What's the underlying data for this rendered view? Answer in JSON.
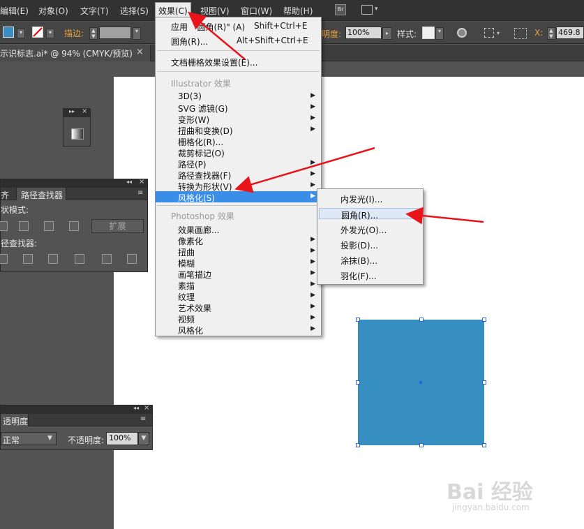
{
  "menubar": {
    "items": [
      "编辑(E)",
      "对象(O)",
      "文字(T)",
      "选择(S)",
      "效果(C)",
      "视图(V)",
      "窗口(W)",
      "帮助(H)"
    ],
    "bridge_label": "Br"
  },
  "control_bar": {
    "stroke_label": "描边:",
    "opacity_label": "明度:",
    "opacity_value": "100%",
    "style_label": "样式:",
    "x_label": "X:",
    "x_value": "469.8"
  },
  "document_tab": {
    "title": "示识标志.ai* @ 94% (CMYK/预览)",
    "close": "×"
  },
  "effect_menu": {
    "apply_label": "应用",
    "apply_arg": "\"圆角(R)\" (A)",
    "apply_shortcut": "Shift+Ctrl+E",
    "last_label": "圆角(R)...",
    "last_shortcut": "Alt+Shift+Ctrl+E",
    "raster_settings": "文档栅格效果设置(E)...",
    "illustrator_header": "Illustrator 效果",
    "illustrator_items": [
      "3D(3)",
      "SVG 滤镜(G)",
      "变形(W)",
      "扭曲和变换(D)",
      "栅格化(R)...",
      "裁剪标记(O)",
      "路径(P)",
      "路径查找器(F)",
      "转换为形状(V)",
      "风格化(S)"
    ],
    "illustrator_has_sub": [
      true,
      true,
      true,
      true,
      false,
      false,
      true,
      true,
      true,
      true
    ],
    "photoshop_header": "Photoshop 效果",
    "photoshop_items": [
      "效果画廊...",
      "像素化",
      "扭曲",
      "模糊",
      "画笔描边",
      "素描",
      "纹理",
      "艺术效果",
      "视频",
      "风格化"
    ],
    "photoshop_has_sub": [
      false,
      true,
      true,
      true,
      true,
      true,
      true,
      true,
      true,
      true
    ]
  },
  "stylize_submenu": {
    "items": [
      "内发光(I)...",
      "圆角(R)...",
      "外发光(O)...",
      "投影(D)...",
      "涂抹(B)...",
      "羽化(F)..."
    ]
  },
  "pathfinder_panel": {
    "tab_align": "齐",
    "tab_title": "路径查找器",
    "shape_modes_label": "状模式:",
    "expand_button": "扩展",
    "pathfinders_label": "径查找器:"
  },
  "transparency_panel": {
    "tab_title": "透明度",
    "blend_mode": "正常",
    "opacity_label": "不透明度:",
    "opacity_value": "100%"
  },
  "watermark": {
    "brand": "Bai 经验",
    "url": "jingyan.baidu.com"
  },
  "colors": {
    "fill": "#378ec1",
    "menu_highlight": "#3b8ee8",
    "arrow": "#e8141a"
  }
}
